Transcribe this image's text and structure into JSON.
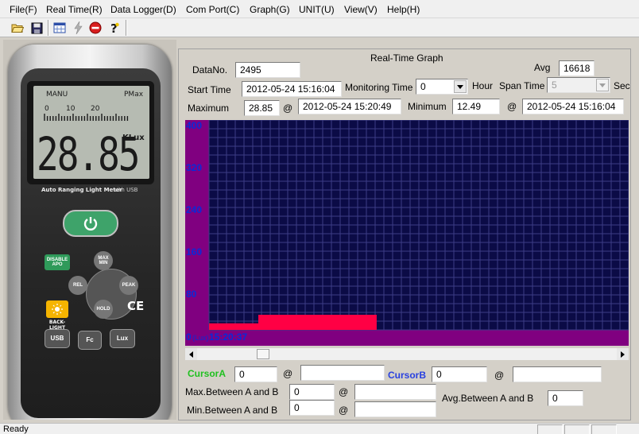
{
  "menubar": {
    "items": [
      "File(F)",
      "Real Time(R)",
      "Data Logger(D)",
      "Com Port(C)",
      "Graph(G)",
      "UNIT(U)",
      "View(V)",
      "Help(H)"
    ]
  },
  "toolbar": {
    "buttons": [
      "open-folder-icon",
      "save-disk-icon",
      "grid-view-icon",
      "lightning-icon",
      "stop-icon",
      "help-icon"
    ]
  },
  "meter": {
    "lcd_mode": "MANU",
    "lcd_pmax": "PMax",
    "lcd_scale": [
      "0",
      "10",
      "20"
    ],
    "lcd_reading": "28.85",
    "lcd_unit": "KLux",
    "brand_text": "Auto Ranging Light Meter",
    "brand_suffix": "with USB",
    "btn_disable_apo": "DISABLE APO",
    "btn_max_min": "MAX MIN",
    "btn_rel": "REL",
    "btn_peak": "PEAK",
    "btn_hold": "HOLD",
    "btn_backlight": "BACK-LIGHT",
    "btn_usb": "USB",
    "btn_fc": "Fc",
    "btn_lux": "Lux",
    "ce_mark": "CE",
    "colors": {
      "power": "#3ea36a",
      "disable_apo": "#2f9a5a",
      "backlight": "#f5b400"
    }
  },
  "graph_panel": {
    "title": "Real-Time Graph",
    "data_no_label": "DataNo.",
    "data_no": "2495",
    "avg_label": "Avg",
    "avg": "16618",
    "start_time_label": "Start Time",
    "start_time": "2012-05-24 15:16:04",
    "monitoring_time_label": "Monitoring Time",
    "monitoring_time": "0",
    "hour_label": "Hour",
    "span_time_label": "Span Time",
    "span_time": "5",
    "sec_label": "Sec",
    "maximum_label": "Maximum",
    "maximum": "28.85",
    "at_symbol": "@",
    "maximum_time": "2012-05-24 15:20:49",
    "minimum_label": "Minimum",
    "minimum": "12.49",
    "minimum_time": "2012-05-24 15:16:04"
  },
  "chart_data": {
    "type": "area",
    "y_tick_labels": [
      "400",
      "320",
      "240",
      "160",
      "80"
    ],
    "origin_label": "0",
    "unit_label": "(Lux)",
    "x_start_label": "15:20:37",
    "ylim": [
      0,
      400
    ],
    "grid": true,
    "series": [
      {
        "x": [
          0,
          0.25,
          0.25,
          0.85
        ],
        "y": [
          12.49,
          12.49,
          28.85,
          28.85
        ]
      }
    ],
    "colors": {
      "background": "#0b0b46",
      "grid": "#3c3c86",
      "left_axis": "#800080",
      "series": "#ff0044",
      "tick_labels": "#0a2ad8"
    }
  },
  "cursor_panel": {
    "cursor_a_label": "CursorA",
    "cursor_a_value": "0",
    "cursor_a_time": "",
    "at_symbol": "@",
    "cursor_b_label": "CursorB",
    "cursor_b_value": "0",
    "cursor_b_time": "",
    "max_between_label": "Max.Between A and B",
    "max_between_value": "0",
    "max_between_time": "",
    "min_between_label": "Min.Between A and B",
    "min_between_value": "0",
    "min_between_time": "",
    "avg_between_label": "Avg.Between A and B",
    "avg_between_value": "0",
    "colors": {
      "cursor_a": "#20c020",
      "cursor_b": "#2840e0"
    }
  },
  "status": {
    "text": "Ready"
  }
}
